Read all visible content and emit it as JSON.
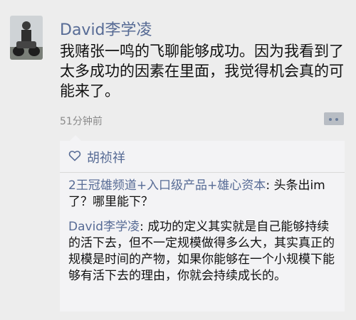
{
  "post": {
    "author": "David李学凌",
    "text": "我赌张一鸣的飞聊能够成功。因为我看到了太多成功的因素在里面，我觉得机会真的可能来了。",
    "time": "51分钟前"
  },
  "likes": {
    "icon": "heart-outline-icon",
    "names": "胡祯祥"
  },
  "comments": [
    {
      "author": "2王冠雄频道+入口级产品+雄心资本",
      "separator": ": ",
      "text": "头条出im了？哪里能下？"
    },
    {
      "author": "David李学凌",
      "separator": ": ",
      "text": "成功的定义其实就是自己能够持续的活下去，但不一定规模做得多么大，其实真正的规模是时间的产物，如果你能够在一个小规模下能够有活下去的理由，你就会持续成长的。"
    }
  ],
  "colors": {
    "link": "#576b95",
    "background": "#ededed",
    "comment_background": "#f3f3f5"
  }
}
